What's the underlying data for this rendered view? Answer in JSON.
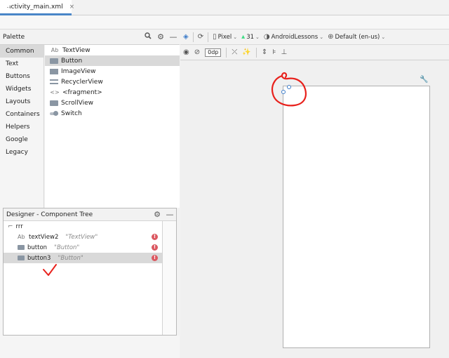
{
  "editor_tabs": [
    {
      "label": "activity_main.xml",
      "close": "×"
    }
  ],
  "palette": {
    "title": "Palette",
    "categories": [
      "Common",
      "Text",
      "Buttons",
      "Widgets",
      "Layouts",
      "Containers",
      "Helpers",
      "Google",
      "Legacy"
    ],
    "selected_category": "Common",
    "widgets": [
      {
        "icon": "textview-icon",
        "label": "TextView",
        "glyph": "Ab"
      },
      {
        "icon": "button-icon",
        "label": "Button"
      },
      {
        "icon": "imageview-icon",
        "label": "ImageView"
      },
      {
        "icon": "recyclerview-icon",
        "label": "RecyclerView"
      },
      {
        "icon": "fragment-icon",
        "label": "<fragment>",
        "glyph": "<>"
      },
      {
        "icon": "scrollview-icon",
        "label": "ScrollView"
      },
      {
        "icon": "switch-icon",
        "label": "Switch"
      }
    ],
    "selected_widget": "Button"
  },
  "component_tree": {
    "title": "Designer - Component Tree",
    "root": {
      "label": "rrr"
    },
    "items": [
      {
        "glyph": "Ab",
        "name": "textView2",
        "text": "\"TextView\"",
        "error": "!"
      },
      {
        "name": "button",
        "text": "\"Button\"",
        "error": "!"
      },
      {
        "name": "button3",
        "text": "\"Button\"",
        "error": "!"
      }
    ],
    "selected_item": "button3"
  },
  "design_toolbar": {
    "device": "Pixel",
    "api_level": "31",
    "theme": "AndroidLessons",
    "locale": "Default (en-us)",
    "margin": "0dp"
  },
  "colors": {
    "accent": "#4a86c8",
    "error": "#db5860",
    "annotation": "#e8211c"
  }
}
